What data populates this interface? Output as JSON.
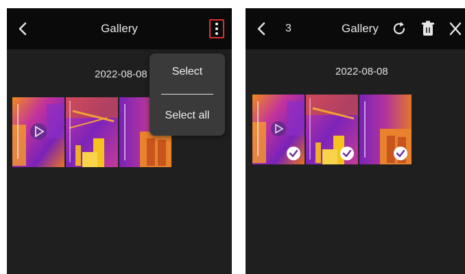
{
  "left_screen": {
    "title": "Gallery",
    "date": "2022-08-08",
    "menu": {
      "items": [
        "Select",
        "Select all"
      ]
    },
    "thumbnails": [
      {
        "name": "video-thumbnail",
        "type": "video"
      },
      {
        "name": "image-thumbnail",
        "type": "image"
      },
      {
        "name": "image-thumbnail",
        "type": "image"
      }
    ],
    "highlight_color": "#e03131"
  },
  "right_screen": {
    "selected_count": "3",
    "title": "Gallery",
    "date": "2022-08-08",
    "icons": [
      "back-icon",
      "rotate-icon",
      "delete-icon",
      "close-icon"
    ],
    "selected_thumbnails": 3
  },
  "colors": {
    "background": "#1f1f1f",
    "appbar": "#0a0a0a",
    "menu": "#3a3a3a"
  }
}
